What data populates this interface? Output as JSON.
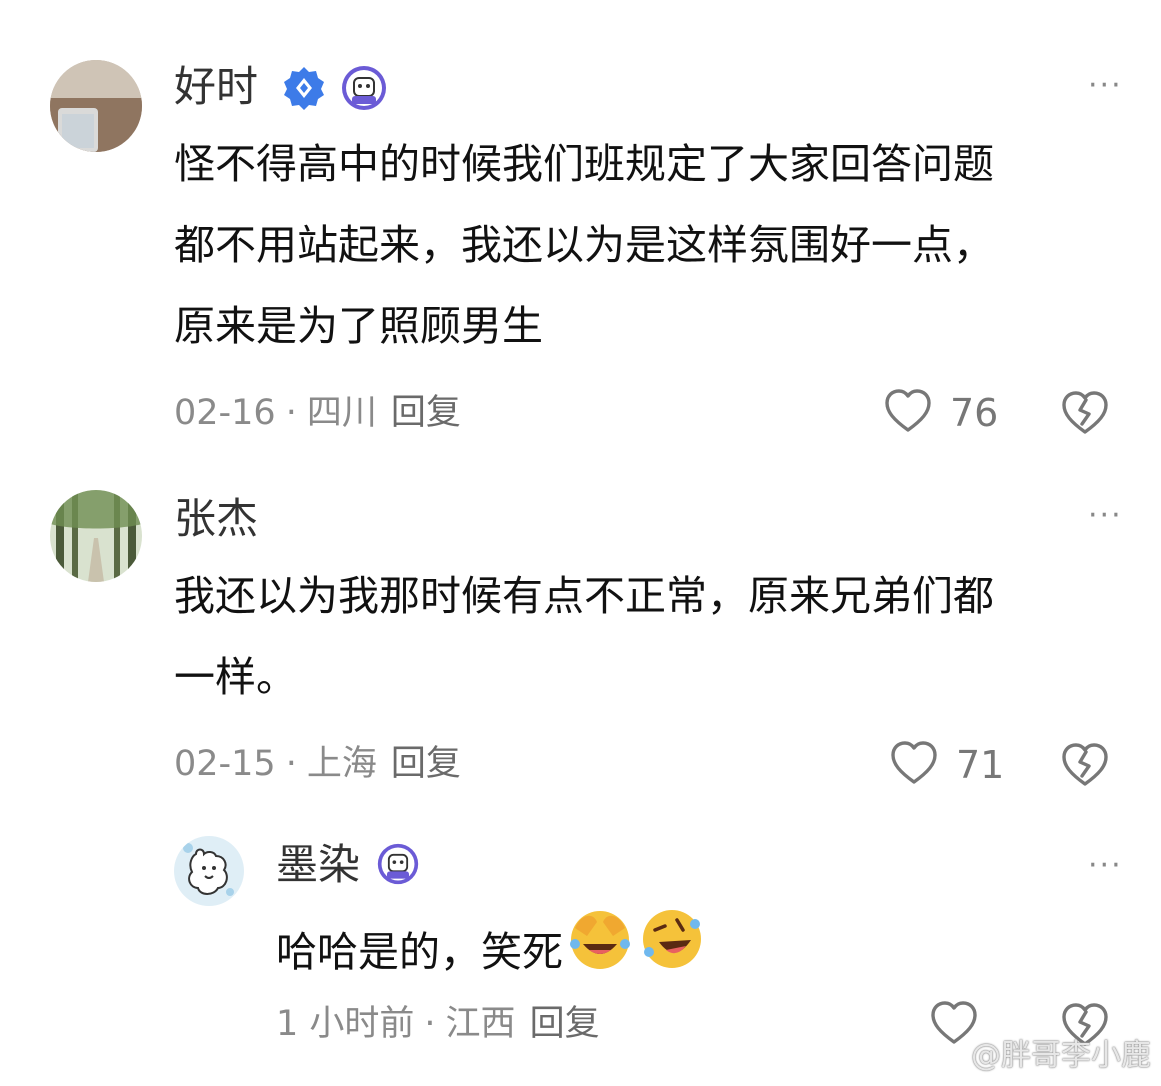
{
  "comments": [
    {
      "username": "好时",
      "lines": [
        "怪不得高中的时候我们班规定了大家回答问题",
        "都不用站起来，我还以为是这样氛围好一点，",
        "原来是为了照顾男生"
      ],
      "date": "02-16",
      "location": "四川",
      "reply_label": "回复",
      "likes": "76"
    },
    {
      "username": "张杰",
      "lines": [
        "我还以为我那时候有点不正常，原来兄弟们都",
        "一样。"
      ],
      "date": "02-15",
      "location": "上海",
      "reply_label": "回复",
      "likes": "71"
    }
  ],
  "reply": {
    "username": "墨染",
    "text": "哈哈是的，笑死",
    "date": "1 小时前",
    "location": "江西",
    "reply_label": "回复"
  },
  "meta_separator": "·",
  "more_label": "···",
  "watermark": "@胖哥李小鹿",
  "colors": {
    "badge_blue": "#3d7be8",
    "badge_purple": "#6b5bd6",
    "emoji_yellow": "#f5c23a"
  },
  "icons": [
    "verified-badge-icon",
    "mascot-badge-icon",
    "heart-icon",
    "broken-heart-icon",
    "more-icon",
    "laughing-emoji-icon",
    "rolling-laughing-emoji-icon"
  ]
}
